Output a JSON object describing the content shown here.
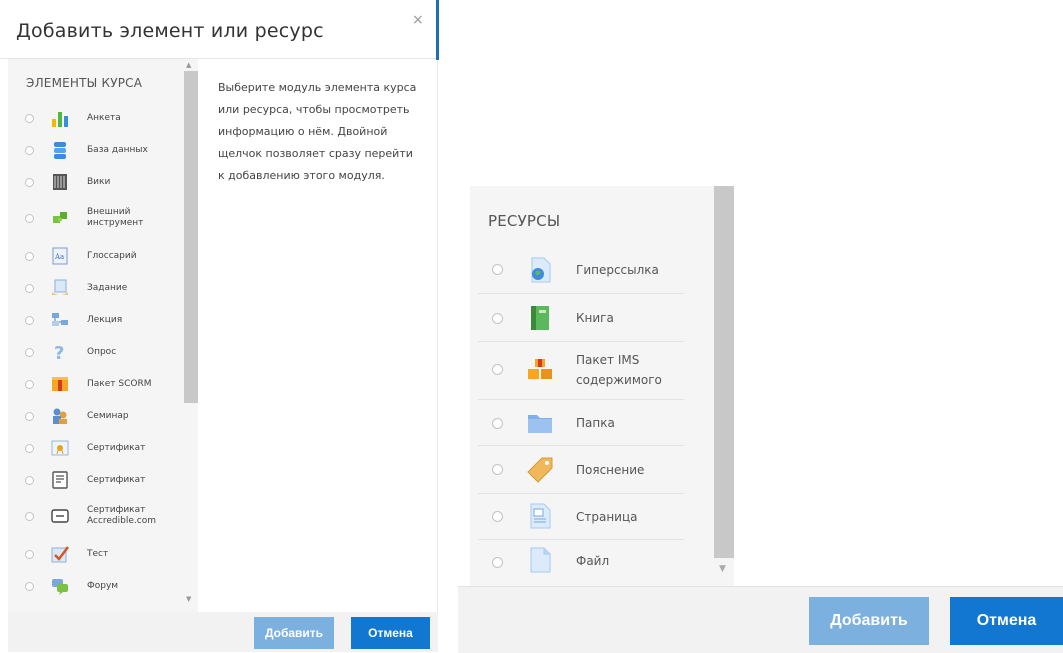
{
  "modal": {
    "title": "Добавить элемент или ресурс",
    "close_glyph": "×",
    "section_heading": "ЭЛЕМЕНТЫ КУРСА",
    "description": "Выберите модуль элемента курса или ресурса, чтобы просмотреть информацию о нём. Двойной щелчок позволяет сразу перейти к добавлению этого модуля.",
    "activities": [
      {
        "label": "Анкета",
        "icon": "chart-bars-icon"
      },
      {
        "label": "База данных",
        "icon": "database-icon"
      },
      {
        "label": "Вики",
        "icon": "wiki-icon"
      },
      {
        "label": "Внешний инструмент",
        "icon": "puzzle-icon"
      },
      {
        "label": "Глоссарий",
        "icon": "glossary-icon"
      },
      {
        "label": "Задание",
        "icon": "assignment-icon"
      },
      {
        "label": "Лекция",
        "icon": "lesson-icon"
      },
      {
        "label": "Опрос",
        "icon": "question-icon"
      },
      {
        "label": "Пакет SCORM",
        "icon": "package-icon"
      },
      {
        "label": "Семинар",
        "icon": "workshop-icon"
      },
      {
        "label": "Сертификат",
        "icon": "certificate-icon"
      },
      {
        "label": "Сертификат",
        "icon": "certificate-doc-icon"
      },
      {
        "label": "Сертификат Accredible.com",
        "icon": "accredible-icon"
      },
      {
        "label": "Тест",
        "icon": "quiz-check-icon"
      },
      {
        "label": "Форум",
        "icon": "forum-icon"
      }
    ],
    "add_label": "Добавить",
    "cancel_label": "Отмена"
  },
  "resources_panel": {
    "heading": "РЕСУРСЫ",
    "items": [
      {
        "label": "Гиперссылка",
        "icon": "url-globe-icon"
      },
      {
        "label": "Книга",
        "icon": "book-icon"
      },
      {
        "label": "Пакет IMS содержимого",
        "icon": "ims-package-icon"
      },
      {
        "label": "Папка",
        "icon": "folder-icon"
      },
      {
        "label": "Пояснение",
        "icon": "label-tag-icon"
      },
      {
        "label": "Страница",
        "icon": "page-icon"
      },
      {
        "label": "Файл",
        "icon": "file-icon"
      }
    ],
    "add_label": "Добавить",
    "cancel_label": "Отмена"
  },
  "colors": {
    "primary": "#1177d1",
    "primary_disabled": "#7cb0de",
    "list_bg": "#f5f5f5"
  }
}
